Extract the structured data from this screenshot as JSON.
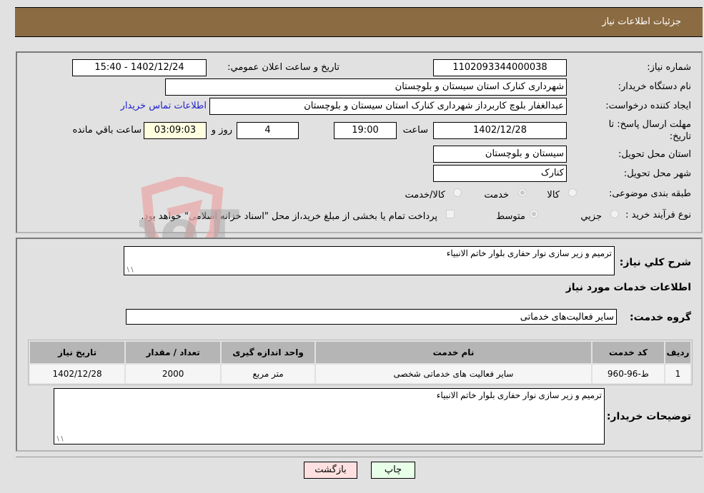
{
  "header": {
    "title": "جزئیات اطلاعات نیاز"
  },
  "form": {
    "need_number": {
      "label": "شماره نیاز:",
      "value": "1102093344000038"
    },
    "announce": {
      "label": "تاریخ و ساعت اعلان عمومي:",
      "value": "1402/12/24 - 15:40"
    },
    "buyer_org": {
      "label": "نام دستگاه خريدار:",
      "value": "شهرداری کنارک استان سیستان و بلوچستان"
    },
    "requester": {
      "label": "ايجاد كننده درخواست:",
      "value": "عبدالغفار بلوچ کاربرداز شهرداری کنارک استان سیستان و بلوچستان"
    },
    "contact_link": "اطلاعات تماس خريدار",
    "deadline": {
      "label": "مهلت ارسال پاسخ: تا تاريخ:",
      "date": "1402/12/28",
      "time_label": "ساعت",
      "time": "19:00",
      "days": "4",
      "days_label": "روز و",
      "remaining": "03:09:03",
      "remaining_label": "ساعت باقي مانده"
    },
    "province": {
      "label": "استان محل تحويل:",
      "value": "سیستان و بلوچستان"
    },
    "city": {
      "label": "شهر محل تحويل:",
      "value": "کنارک"
    },
    "category": {
      "label": "طبقه بندی موضوعی:",
      "options": [
        {
          "label": "کالا",
          "checked": false
        },
        {
          "label": "خدمت",
          "checked": true
        },
        {
          "label": "کالا/خدمت",
          "checked": false
        }
      ]
    },
    "process": {
      "label": "نوع فرآيند خريد :",
      "options": [
        {
          "label": "جزيي",
          "checked": false
        },
        {
          "label": "متوسط",
          "checked": true
        }
      ],
      "treasury_note": "پرداخت تمام يا بخشی از مبلغ خريد،از محل \"اسناد خزانه اسلامی\" خواهد بود.",
      "treasury_checked": false
    }
  },
  "details": {
    "description_label": "شرح كلي نياز:",
    "description": "ترمیم و زیر سازی نوار حفاری بلوار خاتم الانبیاء",
    "services_title": "اطلاعات خدمات مورد نياز",
    "service_group_label": "گروه خدمت:",
    "service_group": "سایر فعالیت‌های خدماتی",
    "table": {
      "headers": [
        "رديف",
        "كد خدمت",
        "نام خدمت",
        "واحد اندازه گيری",
        "تعداد / مقدار",
        "تاريخ نياز"
      ],
      "rows": [
        [
          "1",
          "ط-96-960",
          "سایر فعالیت های خدماتی شخصی",
          "متر مربع",
          "2000",
          "1402/12/28"
        ]
      ]
    },
    "buyer_notes_label": "توضيحات خريدار:",
    "buyer_notes": "ترمیم و زیر سازی نوار حفاری بلوار خاتم الانبیاء"
  },
  "buttons": {
    "print": "چاپ",
    "back": "بازگشت"
  },
  "watermark": {
    "text": "AriaTender.neT"
  }
}
